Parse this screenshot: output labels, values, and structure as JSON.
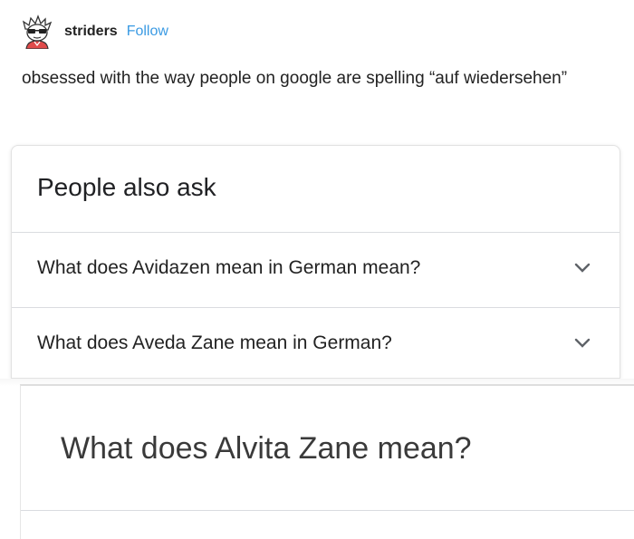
{
  "post": {
    "username": "striders",
    "follow_label": "Follow",
    "text": "obsessed with the way people on google are spelling “auf wiedersehen”"
  },
  "card1": {
    "title": "People also ask",
    "questions": [
      "What does Avidazen mean in German mean?",
      "What does Aveda Zane mean in German?"
    ]
  },
  "card2": {
    "title": "What does Alvita Zane mean?"
  },
  "icons": {
    "avatar": "cartoon-avatar-icon",
    "expand": "chevron-down-icon"
  },
  "colors": {
    "follow_link": "#3a9ae3",
    "text": "#222222",
    "divider": "#dadce0"
  }
}
